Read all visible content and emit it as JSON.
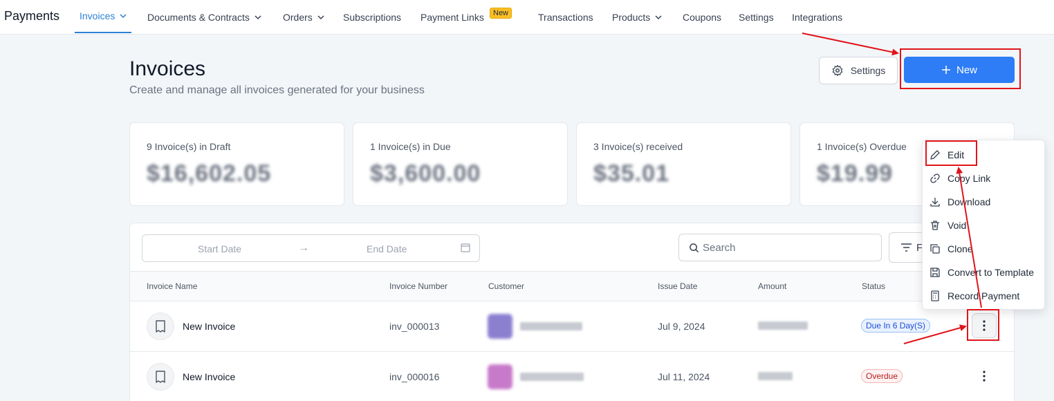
{
  "nav": {
    "brand": "Payments",
    "items": [
      {
        "label": "Invoices",
        "dropdown": true,
        "active": true
      },
      {
        "label": "Documents & Contracts",
        "dropdown": true
      },
      {
        "label": "Orders",
        "dropdown": true
      },
      {
        "label": "Subscriptions"
      },
      {
        "label": "Payment Links",
        "badge": "New"
      },
      {
        "label": "Transactions"
      },
      {
        "label": "Products",
        "dropdown": true
      },
      {
        "label": "Coupons"
      },
      {
        "label": "Settings"
      },
      {
        "label": "Integrations"
      }
    ]
  },
  "header": {
    "title": "Invoices",
    "subtitle": "Create and manage all invoices generated for your business",
    "settings_label": "Settings",
    "new_label": "New"
  },
  "stats": [
    {
      "label": "9 Invoice(s) in Draft",
      "value": "$16,602.05"
    },
    {
      "label": "1 Invoice(s) in Due",
      "value": "$3,600.00"
    },
    {
      "label": "3 Invoice(s) received",
      "value": "$35.01"
    },
    {
      "label": "1 Invoice(s) Overdue",
      "value": "$19.99"
    }
  ],
  "filters": {
    "start_date": "Start Date",
    "end_date": "End Date",
    "search_placeholder": "Search",
    "filter_label": "F"
  },
  "table": {
    "columns": [
      "Invoice Name",
      "Invoice Number",
      "Customer",
      "Issue Date",
      "Amount",
      "Status"
    ],
    "rows": [
      {
        "name": "New Invoice",
        "number": "inv_000013",
        "issue_date": "Jul 9, 2024",
        "status": "Due In 6 Day(S)",
        "status_type": "due"
      },
      {
        "name": "New Invoice",
        "number": "inv_000016",
        "issue_date": "Jul 11, 2024",
        "status": "Overdue",
        "status_type": "overdue"
      }
    ]
  },
  "row_menu": {
    "items": [
      {
        "label": "Edit",
        "icon": "pencil-icon"
      },
      {
        "label": "Copy Link",
        "icon": "link-icon"
      },
      {
        "label": "Download",
        "icon": "download-icon"
      },
      {
        "label": "Void",
        "icon": "trash-icon"
      },
      {
        "label": "Clone",
        "icon": "copy-icon"
      },
      {
        "label": "Convert to Template",
        "icon": "save-icon"
      },
      {
        "label": "Record Payment",
        "icon": "calculator-icon"
      }
    ]
  },
  "colors": {
    "accent": "#2e7cf6",
    "nav_active": "#2b7fd6",
    "annotation": "#e0141a",
    "badge": "#fbbf24"
  }
}
